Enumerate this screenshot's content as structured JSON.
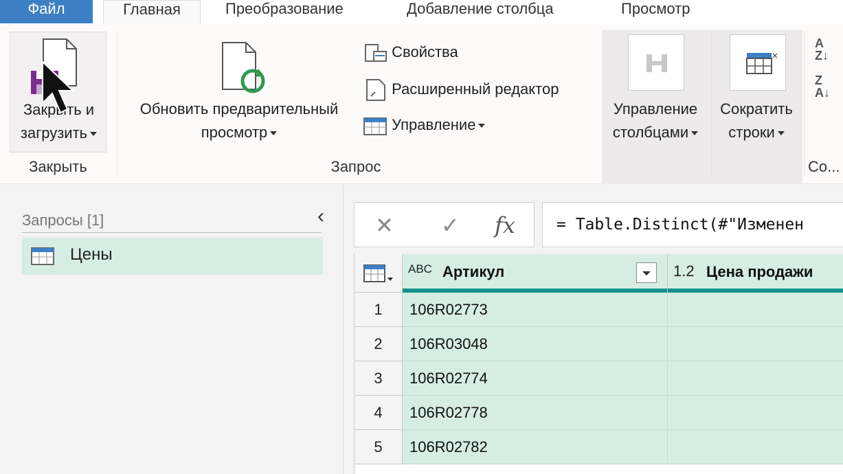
{
  "tabs": {
    "file": "Файл",
    "home": "Главная",
    "transform": "Преобразование",
    "add_column": "Добавление столбца",
    "view": "Просмотр"
  },
  "ribbon": {
    "close_group": {
      "button_line1": "Закрыть и",
      "button_line2": "загрузить",
      "label": "Закрыть"
    },
    "query_group": {
      "refresh_line1": "Обновить предварительный",
      "refresh_line2": "просмотр",
      "properties": "Свойства",
      "advanced_editor": "Расширенный редактор",
      "manage": "Управление",
      "label": "Запрос"
    },
    "manage_columns_line1": "Управление",
    "manage_columns_line2": "столбцами",
    "reduce_rows_line1": "Сократить",
    "reduce_rows_line2": "строки",
    "sort_label": "Со..."
  },
  "queries_panel": {
    "header": "Запросы [1]",
    "items": [
      {
        "label": "Цены"
      }
    ]
  },
  "formula_bar": {
    "cancel_glyph": "✕",
    "confirm_glyph": "✓",
    "fx_glyph": "fx",
    "formula": "= Table.Distinct(#\"Изменен"
  },
  "grid": {
    "columns": [
      {
        "type_label": "ABC",
        "name": "Артикул"
      },
      {
        "type_label": "1.2",
        "name": "Цена продажи"
      }
    ],
    "rows": [
      {
        "num": "1",
        "cells": [
          "106R02773",
          ""
        ]
      },
      {
        "num": "2",
        "cells": [
          "106R03048",
          ""
        ]
      },
      {
        "num": "3",
        "cells": [
          "106R02774",
          ""
        ]
      },
      {
        "num": "4",
        "cells": [
          "106R02778",
          ""
        ]
      },
      {
        "num": "5",
        "cells": [
          "106R02782",
          ""
        ]
      }
    ]
  },
  "colors": {
    "file_tab": "#3c7fc4",
    "selection_green": "#d6ede3",
    "header_bar": "#159088"
  }
}
